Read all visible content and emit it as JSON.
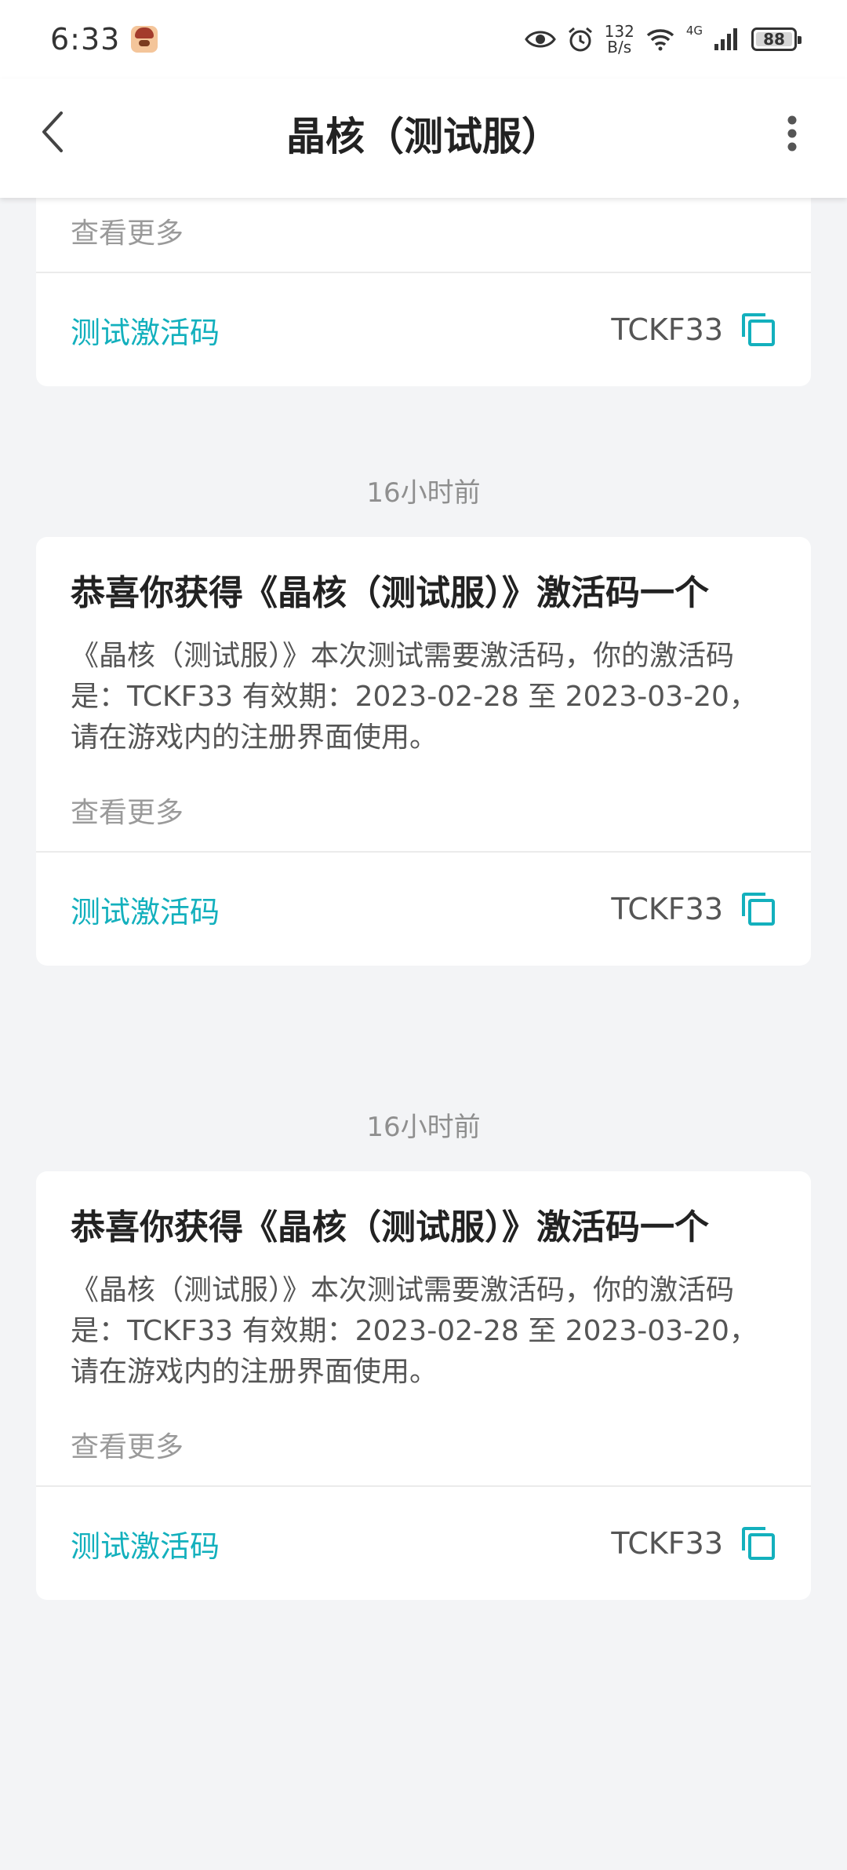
{
  "status_bar": {
    "time": "6:33",
    "speed_value": "132",
    "speed_unit": "B/s",
    "network": "4G",
    "battery": "88"
  },
  "app_bar": {
    "title": "晶核（测试服）"
  },
  "cards": [
    {
      "see_more": "查看更多",
      "code_label": "测试激活码",
      "code_value": "TCKF33"
    },
    {
      "timestamp": "16小时前",
      "title": "恭喜你获得《晶核（测试服）》激活码一个",
      "body": "《晶核（测试服）》本次测试需要激活码，你的激活码是：TCKF33 有效期：2023-02-28 至 2023-03-20，请在游戏内的注册界面使用。",
      "see_more": "查看更多",
      "code_label": "测试激活码",
      "code_value": "TCKF33"
    },
    {
      "timestamp": "16小时前",
      "title": "恭喜你获得《晶核（测试服）》激活码一个",
      "body": "《晶核（测试服）》本次测试需要激活码，你的激活码是：TCKF33 有效期：2023-02-28 至 2023-03-20，请在游戏内的注册界面使用。",
      "see_more": "查看更多",
      "code_label": "测试激活码",
      "code_value": "TCKF33"
    }
  ],
  "colors": {
    "accent": "#13b0bd",
    "background": "#f3f4f6",
    "card": "#ffffff",
    "muted_text": "#9a9a9a"
  },
  "icons": [
    "back-arrow-icon",
    "more-vertical-icon",
    "copy-icon",
    "eye-icon",
    "alarm-icon",
    "wifi-icon",
    "signal-icon",
    "battery-icon"
  ]
}
